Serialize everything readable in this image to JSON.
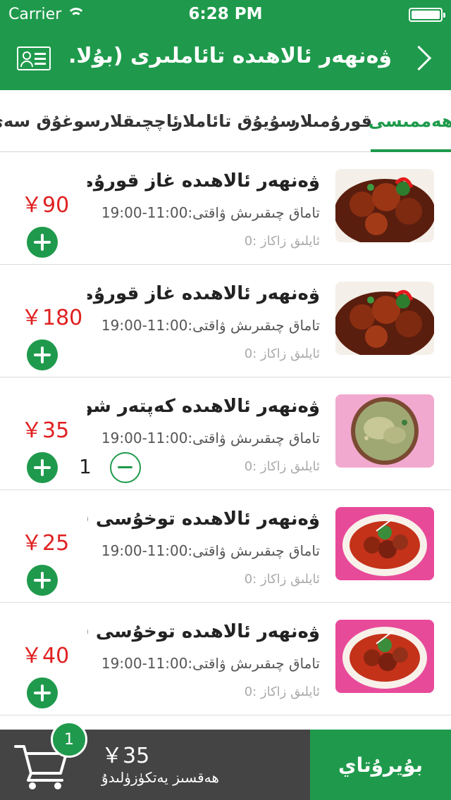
{
  "status_bar": {
    "carrier": "Carrier",
    "time": "6:28 PM"
  },
  "nav": {
    "title": "ۋەنهەر ئالاھىدە تائاملىرى (بۇلا...",
    "card_icon": "id-card-icon",
    "back_icon": "chevron-right-icon"
  },
  "tabs": [
    {
      "label": "ھەممىسى",
      "active": true
    },
    {
      "label": "قورۇمىلار",
      "active": false
    },
    {
      "label": "سۇيۇق تائاملار",
      "active": false
    },
    {
      "label": "ئاچچىقلار",
      "active": false
    },
    {
      "label": "سوغۇق سەي",
      "active": false
    }
  ],
  "items": [
    {
      "name": "ۋەنهەر ئالاھىدە غاز قورۇمىس..",
      "time": "تاماق چىقىرىش ۋاقتى:11:00-19:00",
      "sales": "ئايلىق زاكاز :0",
      "price": "￥90",
      "qty": ""
    },
    {
      "name": "ۋەنهەر ئالاھىدە غاز قورۇمىس..",
      "time": "تاماق چىقىرىش ۋاقتى:11:00-19:00",
      "sales": "ئايلىق زاكاز :0",
      "price": "￥180",
      "qty": ""
    },
    {
      "name": "ۋەنهەر ئالاھىدە كەپتەر شورپ..",
      "time": "تاماق چىقىرىش ۋاقتى:11:00-19:00",
      "sales": "ئايلىق زاكاز :0",
      "price": "￥35",
      "qty": "1"
    },
    {
      "name": "ۋەنهەر ئالاھىدە توخۇسى (كى..",
      "time": "تاماق چىقىرىش ۋاقتى:11:00-19:00",
      "sales": "ئايلىق زاكاز :0",
      "price": "￥25",
      "qty": ""
    },
    {
      "name": "ۋەنهەر ئالاھىدە توخۇسى (ئوت..",
      "time": "تاماق چىقىرىش ۋاقتى:11:00-19:00",
      "sales": "ئايلىق زاكاز :0",
      "price": "￥40",
      "qty": ""
    }
  ],
  "cart": {
    "count": "1",
    "total": "￥35",
    "delivery_note": "ھەقسىز يەتكۈزۈلىدۇ",
    "checkout_label": "بۇيرۇتاي",
    "icon": "shopping-cart-icon"
  },
  "colors": {
    "brand_green": "#1f9a4c",
    "price_red": "#e02020",
    "bar_dark": "#444444"
  }
}
